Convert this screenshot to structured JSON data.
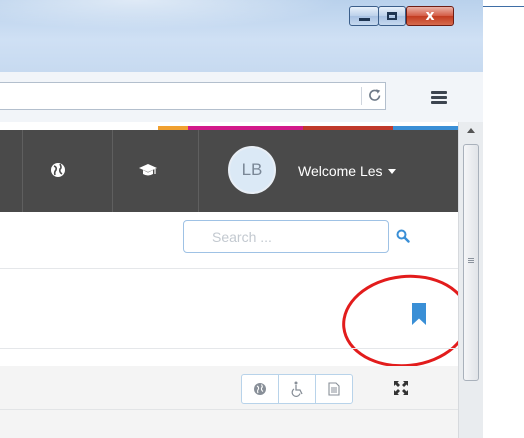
{
  "window": {
    "close_glyph": "x",
    "title_bar_color": "#c7daf0",
    "close_color": "#c23b20"
  },
  "toolbar": {
    "url_value": "",
    "reload_icon": "reload-icon",
    "menu_icon": "hamburger-icon"
  },
  "nav": {
    "stripe_colors": [
      "#f0a030",
      "#d2198a",
      "#c0392b",
      "#3a8fd6"
    ],
    "avatar_initials": "LB",
    "welcome_label": "Welcome Les",
    "icons": [
      "globe-icon",
      "graduation-cap-icon",
      "chevron-down-icon"
    ],
    "background_color": "#4a4a4a"
  },
  "search": {
    "placeholder": "Search ...",
    "value": "",
    "icon": "search-icon",
    "accent_color": "#3a8fd6"
  },
  "content": {
    "bookmark_icon": "bookmark-icon",
    "bookmark_color": "#3a8fd6",
    "annotation_color": "#e21c1c",
    "toolbar_icons": [
      "globe-icon",
      "accessibility-icon",
      "document-icon",
      "expand-icon"
    ]
  }
}
